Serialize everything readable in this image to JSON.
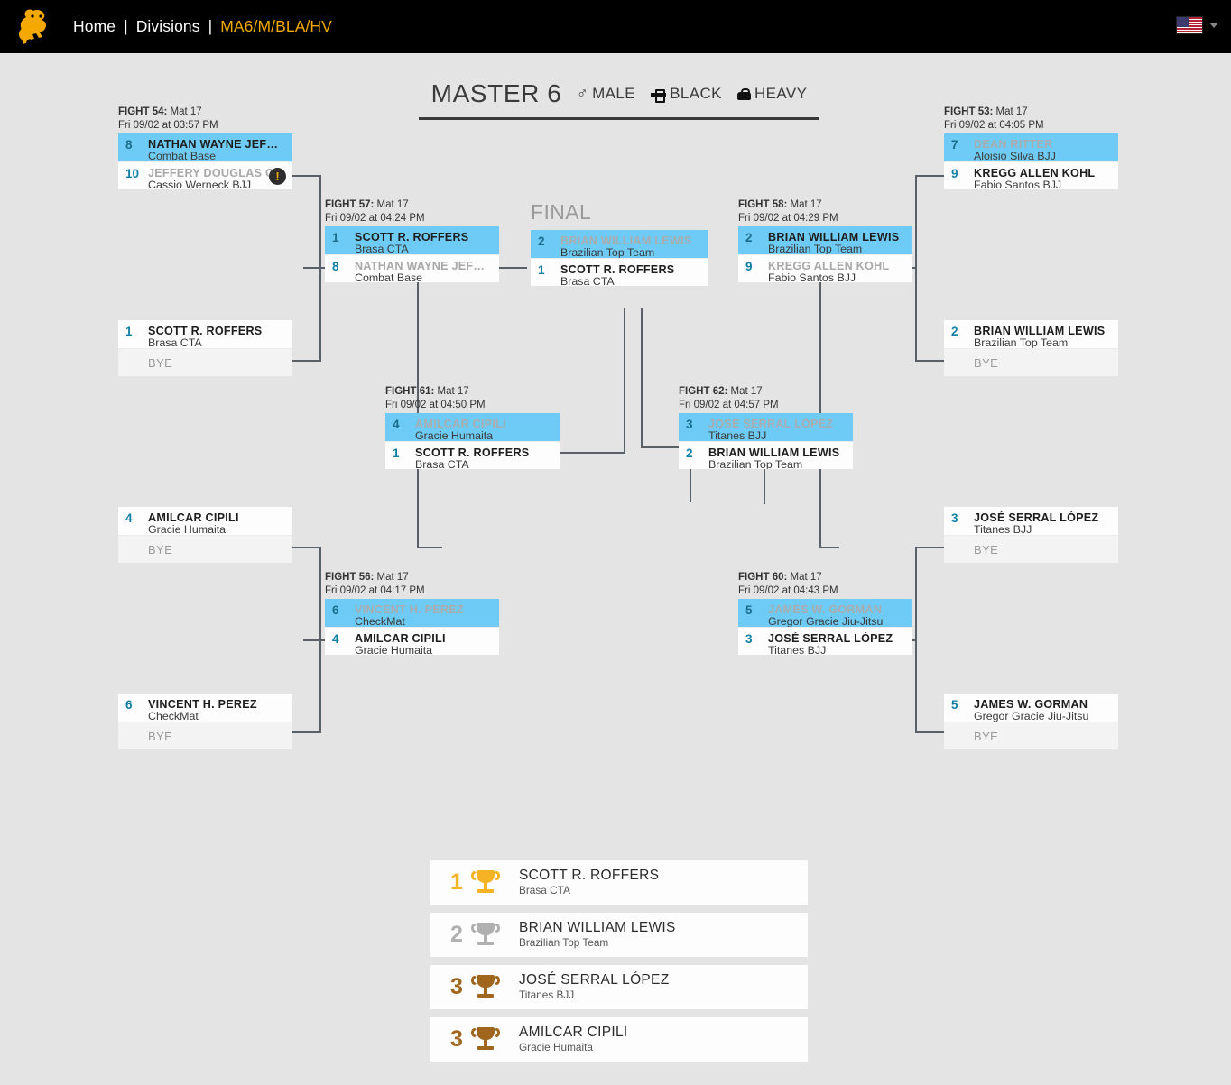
{
  "topbar": {
    "logo_icon": "tiger-logo-icon",
    "nav": {
      "home": "Home",
      "divisions": "Divisions",
      "current": "MA6/M/BLA/HV",
      "sep": "|"
    },
    "flag_icon": "us-flag-icon",
    "caret_icon": "chevron-down-icon"
  },
  "division": {
    "name": "MASTER 6",
    "gender": "MALE",
    "gender_icon": "male-symbol-icon",
    "belt": "BLACK",
    "belt_icon": "belt-icon",
    "weight": "HEAVY",
    "weight_icon": "weight-icon"
  },
  "final_label": "FINAL",
  "bye_label": "BYE",
  "colors": {
    "highlight": "#6ecbf5",
    "seed": "#0f7fa5",
    "accent": "#f5a800",
    "gold": "#f5b324",
    "silver": "#b0b0b0",
    "bronze": "#a0661e",
    "line": "#5a6068"
  },
  "matches": {
    "f54": {
      "label_fight": "FIGHT 54:",
      "label_mat": " Mat 17",
      "label_time": "Fri 09/02 at 03:57 PM",
      "rows": [
        {
          "seed": "8",
          "name": "NATHAN WAYNE JEF…",
          "team": "Combat Base"
        },
        {
          "seed": "10",
          "name": "JEFFERY DOUGLAS C…",
          "team": "Cassio Werneck BJJ",
          "badge": "!"
        }
      ]
    },
    "l_top_bye": {
      "rows": [
        {
          "seed": "1",
          "name": "SCOTT R. ROFFERS",
          "team": "Brasa CTA"
        },
        {
          "bye": true
        }
      ]
    },
    "f57": {
      "label_fight": "FIGHT 57:",
      "label_mat": " Mat 17",
      "label_time": "Fri 09/02 at 04:24 PM",
      "rows": [
        {
          "seed": "1",
          "name": "SCOTT R. ROFFERS",
          "team": "Brasa CTA"
        },
        {
          "seed": "8",
          "name": "NATHAN WAYNE JEF…",
          "team": "Combat Base"
        }
      ]
    },
    "l_mid_bye": {
      "rows": [
        {
          "seed": "4",
          "name": "AMILCAR CIPILI",
          "team": "Gracie Humaita"
        },
        {
          "bye": true
        }
      ]
    },
    "l_bot_bye": {
      "rows": [
        {
          "seed": "6",
          "name": "VINCENT H. PEREZ",
          "team": "CheckMat"
        },
        {
          "bye": true
        }
      ]
    },
    "f56": {
      "label_fight": "FIGHT 56:",
      "label_mat": " Mat 17",
      "label_time": "Fri 09/02 at 04:17 PM",
      "rows": [
        {
          "seed": "6",
          "name": "VINCENT H. PEREZ",
          "team": "CheckMat"
        },
        {
          "seed": "4",
          "name": "AMILCAR CIPILI",
          "team": "Gracie Humaita"
        }
      ]
    },
    "f61": {
      "label_fight": "FIGHT 61:",
      "label_mat": " Mat 17",
      "label_time": "Fri 09/02 at 04:50 PM",
      "rows": [
        {
          "seed": "4",
          "name": "AMILCAR CIPILI",
          "team": "Gracie Humaita"
        },
        {
          "seed": "1",
          "name": "SCOTT R. ROFFERS",
          "team": "Brasa CTA"
        }
      ]
    },
    "final": {
      "rows": [
        {
          "seed": "2",
          "name": "BRIAN WILLIAM LEWIS",
          "team": "Brazilian Top Team"
        },
        {
          "seed": "1",
          "name": "SCOTT R. ROFFERS",
          "team": "Brasa CTA"
        }
      ]
    },
    "f62": {
      "label_fight": "FIGHT 62:",
      "label_mat": " Mat 17",
      "label_time": "Fri 09/02 at 04:57 PM",
      "rows": [
        {
          "seed": "3",
          "name": "JOSÉ SERRAL LÓPEZ",
          "team": "Titanes BJJ"
        },
        {
          "seed": "2",
          "name": "BRIAN WILLIAM LEWIS",
          "team": "Brazilian Top Team"
        }
      ]
    },
    "f58": {
      "label_fight": "FIGHT 58:",
      "label_mat": " Mat 17",
      "label_time": "Fri 09/02 at 04:29 PM",
      "rows": [
        {
          "seed": "2",
          "name": "BRIAN WILLIAM LEWIS",
          "team": "Brazilian Top Team"
        },
        {
          "seed": "9",
          "name": "KREGG ALLEN KOHL",
          "team": "Fabio Santos BJJ"
        }
      ]
    },
    "f60": {
      "label_fight": "FIGHT 60:",
      "label_mat": " Mat 17",
      "label_time": "Fri 09/02 at 04:43 PM",
      "rows": [
        {
          "seed": "5",
          "name": "JAMES W. GORMAN",
          "team": "Gregor Gracie Jiu-Jitsu"
        },
        {
          "seed": "3",
          "name": "JOSÉ SERRAL LÓPEZ",
          "team": "Titanes BJJ"
        }
      ]
    },
    "f53": {
      "label_fight": "FIGHT 53:",
      "label_mat": " Mat 17",
      "label_time": "Fri 09/02 at 04:05 PM",
      "rows": [
        {
          "seed": "7",
          "name": "DEAN RITTER",
          "team": "Aloisio Silva BJJ"
        },
        {
          "seed": "9",
          "name": "KREGG ALLEN KOHL",
          "team": "Fabio Santos BJJ"
        }
      ]
    },
    "r_top_bye": {
      "rows": [
        {
          "seed": "2",
          "name": "BRIAN WILLIAM LEWIS",
          "team": "Brazilian Top Team"
        },
        {
          "bye": true
        }
      ]
    },
    "r_mid_bye": {
      "rows": [
        {
          "seed": "3",
          "name": "JOSÉ SERRAL LÓPEZ",
          "team": "Titanes BJJ"
        },
        {
          "bye": true
        }
      ]
    },
    "r_bot_bye": {
      "rows": [
        {
          "seed": "5",
          "name": "JAMES W. GORMAN",
          "team": "Gregor Gracie Jiu-Jitsu"
        },
        {
          "bye": true
        }
      ]
    }
  },
  "podium": [
    {
      "place": "1",
      "name": "SCOTT R. ROFFERS",
      "team": "Brasa CTA",
      "medal": "gold"
    },
    {
      "place": "2",
      "name": "BRIAN WILLIAM LEWIS",
      "team": "Brazilian Top Team",
      "medal": "silver"
    },
    {
      "place": "3",
      "name": "JOSÉ SERRAL LÓPEZ",
      "team": "Titanes BJJ",
      "medal": "bronze"
    },
    {
      "place": "3",
      "name": "AMILCAR CIPILI",
      "team": "Gracie Humaita",
      "medal": "bronze"
    }
  ]
}
